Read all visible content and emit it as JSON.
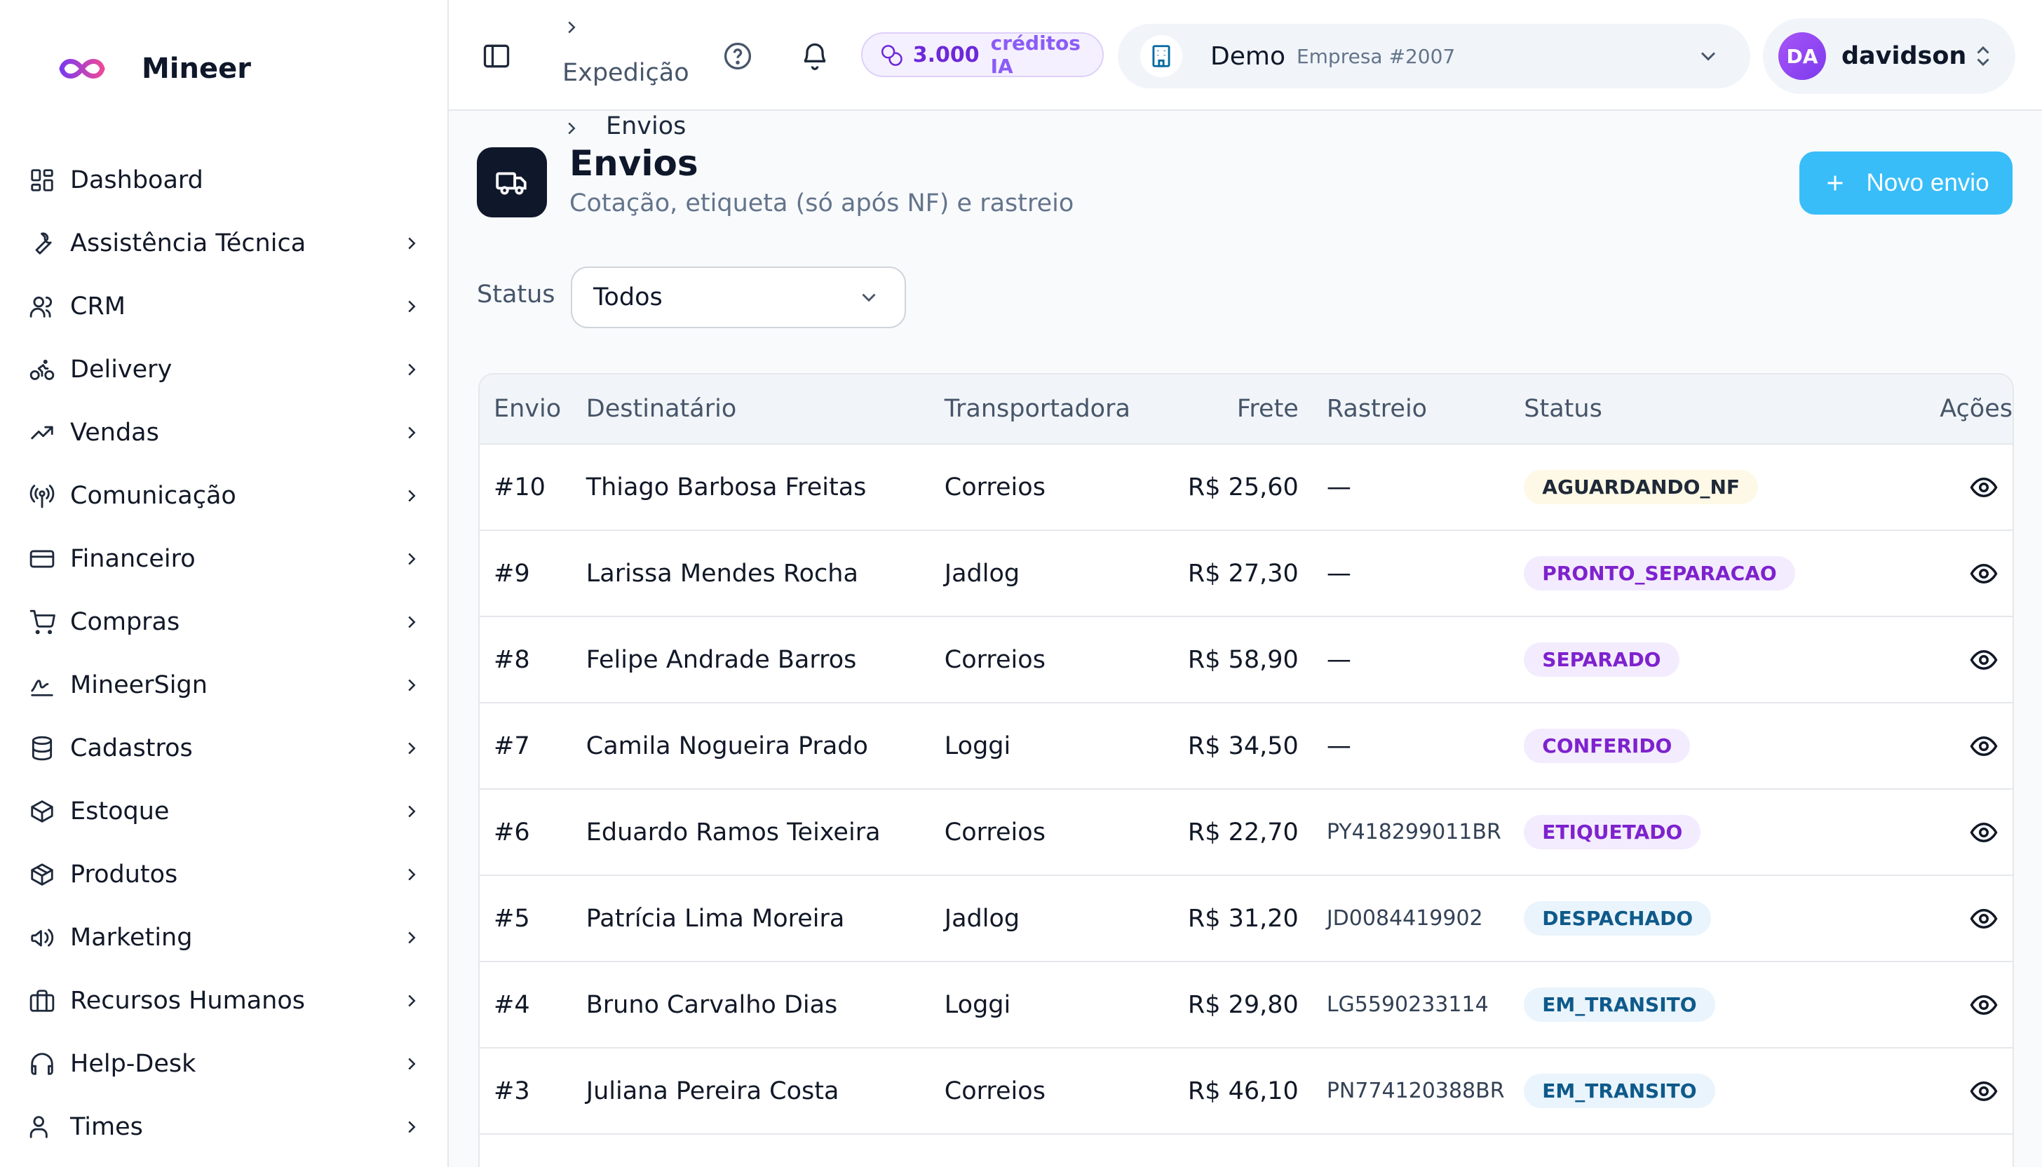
{
  "brand": {
    "name": "Mineer"
  },
  "sidebar": {
    "items": [
      {
        "label": "Dashboard",
        "icon": "dashboard-icon",
        "has_chevron": false
      },
      {
        "label": "Assistência Técnica",
        "icon": "wrench-icon",
        "has_chevron": true
      },
      {
        "label": "CRM",
        "icon": "users-icon",
        "has_chevron": true
      },
      {
        "label": "Delivery",
        "icon": "bike-icon",
        "has_chevron": true
      },
      {
        "label": "Vendas",
        "icon": "trending-up-icon",
        "has_chevron": true
      },
      {
        "label": "Comunicação",
        "icon": "broadcast-icon",
        "has_chevron": true
      },
      {
        "label": "Financeiro",
        "icon": "credit-card-icon",
        "has_chevron": true
      },
      {
        "label": "Compras",
        "icon": "cart-icon",
        "has_chevron": true
      },
      {
        "label": "MineerSign",
        "icon": "signature-icon",
        "has_chevron": true
      },
      {
        "label": "Cadastros",
        "icon": "database-icon",
        "has_chevron": true
      },
      {
        "label": "Estoque",
        "icon": "box-icon",
        "has_chevron": true
      },
      {
        "label": "Produtos",
        "icon": "package-icon",
        "has_chevron": true
      },
      {
        "label": "Marketing",
        "icon": "megaphone-icon",
        "has_chevron": true
      },
      {
        "label": "Recursos Humanos",
        "icon": "briefcase-icon",
        "has_chevron": true
      },
      {
        "label": "Help-Desk",
        "icon": "headphones-icon",
        "has_chevron": true
      },
      {
        "label": "Times",
        "icon": "team-icon",
        "has_chevron": true
      }
    ]
  },
  "topbar": {
    "breadcrumb_parent": "Expedição",
    "credits_value": "3.000",
    "credits_label": "créditos IA",
    "company_name": "Demo",
    "company_sub": "Empresa #2007",
    "user_initials": "DA",
    "user_name": "davidson"
  },
  "page": {
    "breadcrumb_current": "Envios",
    "title": "Envios",
    "subtitle": "Cotação, etiqueta (só após NF) e rastreio",
    "new_button_label": "Novo envio",
    "filter_label": "Status",
    "filter_value": "Todos"
  },
  "table": {
    "headers": {
      "envio": "Envio",
      "destinatario": "Destinatário",
      "transportadora": "Transportadora",
      "frete": "Frete",
      "rastreio": "Rastreio",
      "status": "Status",
      "acoes": "Ações"
    },
    "rows": [
      {
        "envio": "#10",
        "destinatario": "Thiago Barbosa Freitas",
        "transportadora": "Correios",
        "frete": "R$ 25,60",
        "rastreio": "—",
        "status": "AGUARDANDO_NF",
        "status_bg": "#fef9e7",
        "status_fg": "#1f2937"
      },
      {
        "envio": "#9",
        "destinatario": "Larissa Mendes Rocha",
        "transportadora": "Jadlog",
        "frete": "R$ 27,30",
        "rastreio": "—",
        "status": "PRONTO_SEPARACAO",
        "status_bg": "#f3ecfe",
        "status_fg": "#7e22ce"
      },
      {
        "envio": "#8",
        "destinatario": "Felipe Andrade Barros",
        "transportadora": "Correios",
        "frete": "R$ 58,90",
        "rastreio": "—",
        "status": "SEPARADO",
        "status_bg": "#f3ecfe",
        "status_fg": "#7e22ce"
      },
      {
        "envio": "#7",
        "destinatario": "Camila Nogueira Prado",
        "transportadora": "Loggi",
        "frete": "R$ 34,50",
        "rastreio": "—",
        "status": "CONFERIDO",
        "status_bg": "#f3ecfe",
        "status_fg": "#7e22ce"
      },
      {
        "envio": "#6",
        "destinatario": "Eduardo Ramos Teixeira",
        "transportadora": "Correios",
        "frete": "R$ 22,70",
        "rastreio": "PY418299011BR",
        "status": "ETIQUETADO",
        "status_bg": "#f3ecfe",
        "status_fg": "#7e22ce"
      },
      {
        "envio": "#5",
        "destinatario": "Patrícia Lima Moreira",
        "transportadora": "Jadlog",
        "frete": "R$ 31,20",
        "rastreio": "JD0084419902",
        "status": "DESPACHADO",
        "status_bg": "#eaf4fc",
        "status_fg": "#0e5a8a"
      },
      {
        "envio": "#4",
        "destinatario": "Bruno Carvalho Dias",
        "transportadora": "Loggi",
        "frete": "R$ 29,80",
        "rastreio": "LG5590233114",
        "status": "EM_TRANSITO",
        "status_bg": "#eaf4fc",
        "status_fg": "#0e5a8a"
      },
      {
        "envio": "#3",
        "destinatario": "Juliana Pereira Costa",
        "transportadora": "Correios",
        "frete": "R$ 46,10",
        "rastreio": "PN774120388BR",
        "status": "EM_TRANSITO",
        "status_bg": "#eaf4fc",
        "status_fg": "#0e5a8a"
      }
    ]
  },
  "colors": {
    "accent": "#38bdf8",
    "brand_dark": "#0f172a",
    "credits": "#6d28d9"
  }
}
